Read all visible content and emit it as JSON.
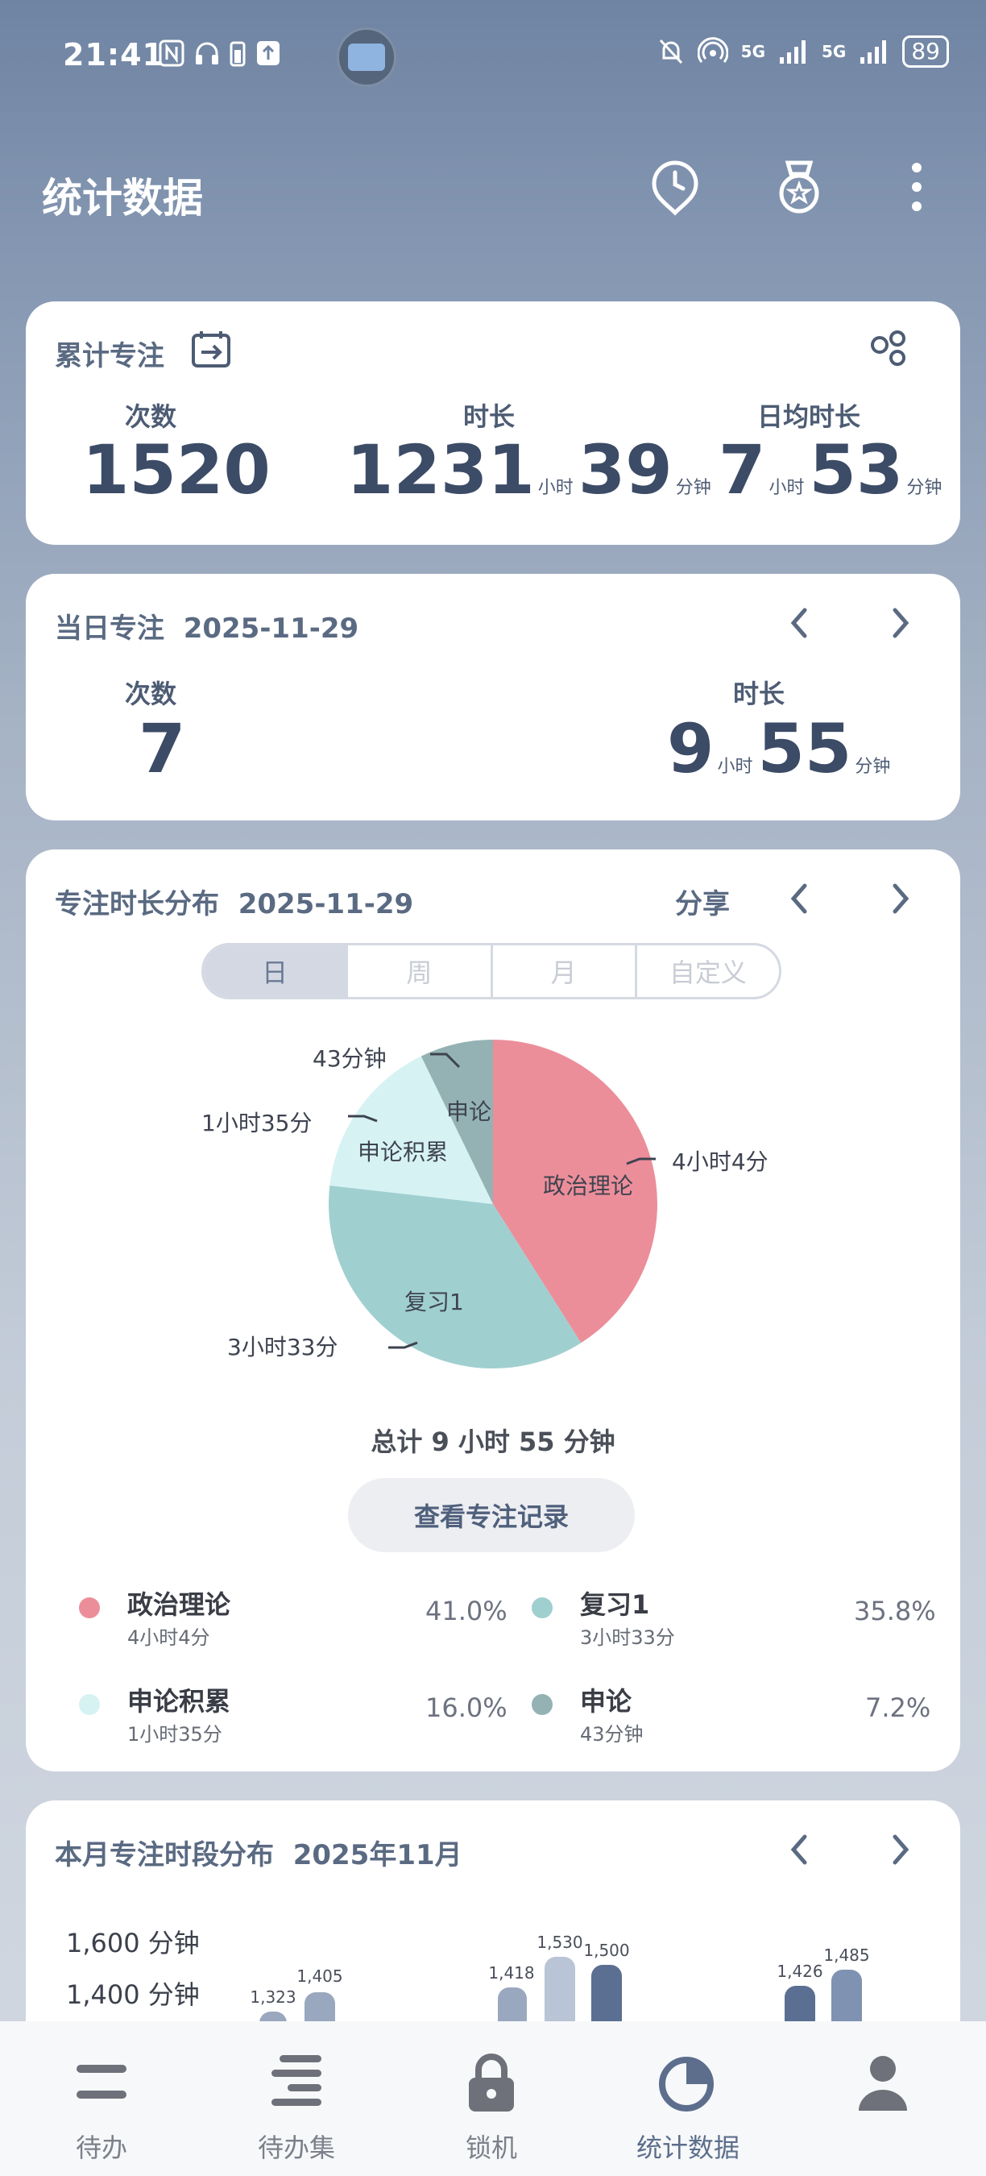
{
  "status_bar": {
    "time": "21:41",
    "signal_left": "5G",
    "signal_right": "5G",
    "battery": "89"
  },
  "header": {
    "title": "统计数据"
  },
  "cumulative": {
    "title": "累计专注",
    "count_label": "次数",
    "count_value": "1520",
    "duration_label": "时长",
    "duration_hours": "1231",
    "duration_minutes": "39",
    "daily_label": "日均时长",
    "daily_hours": "7",
    "daily_minutes": "53",
    "unit_hour": "小时",
    "unit_minute": "分钟"
  },
  "daily": {
    "title": "当日专注",
    "date": "2025-11-29",
    "count_label": "次数",
    "count_value": "7",
    "duration_label": "时长",
    "duration_hours": "9",
    "duration_minutes": "55",
    "unit_hour": "小时",
    "unit_minute": "分钟"
  },
  "distribution": {
    "title": "专注时长分布",
    "date": "2025-11-29",
    "share": "分享",
    "tabs": [
      "日",
      "周",
      "月",
      "自定义"
    ],
    "total": "总计 9 小时 55 分钟",
    "records_button": "查看专注记录",
    "slices": [
      {
        "name": "政治理论",
        "duration": "4小时4分",
        "percent": "41.0%",
        "value": 41.0,
        "color": "#ec8e9a"
      },
      {
        "name": "复习1",
        "duration": "3小时33分",
        "percent": "35.8%",
        "value": 35.8,
        "color": "#a0cfd0"
      },
      {
        "name": "申论积累",
        "duration": "1小时35分",
        "percent": "16.0%",
        "value": 16.0,
        "color": "#d6f2f3"
      },
      {
        "name": "申论",
        "duration": "43分钟",
        "percent": "7.2%",
        "value": 7.2,
        "color": "#94b2b3"
      }
    ],
    "outer_labels": {
      "zhengzhi": "4小时4分",
      "fuxi": "3小时33分",
      "shenlun_jilei": "1小时35分",
      "shenlun": "43分钟"
    }
  },
  "monthly": {
    "title": "本月专注时段分布",
    "date": "2025年11月",
    "y_ticks": [
      "1,600 分钟",
      "1,400 分钟"
    ],
    "bars": [
      {
        "value": "1,323",
        "color": "#9aa8bf"
      },
      {
        "value": "1,405",
        "color": "#9aa8bf"
      },
      {
        "value": "1,418",
        "color": "#9aa8bf"
      },
      {
        "value": "1,530",
        "color": "#b9c4d6"
      },
      {
        "value": "1,500",
        "color": "#5a6f92"
      },
      {
        "value": "1,426",
        "color": "#5a6f92"
      },
      {
        "value": "1,485",
        "color": "#7f92b2"
      }
    ]
  },
  "nav": [
    {
      "label": "待办"
    },
    {
      "label": "待办集"
    },
    {
      "label": "锁机"
    },
    {
      "label": "统计数据"
    },
    {
      "label": ""
    }
  ]
}
